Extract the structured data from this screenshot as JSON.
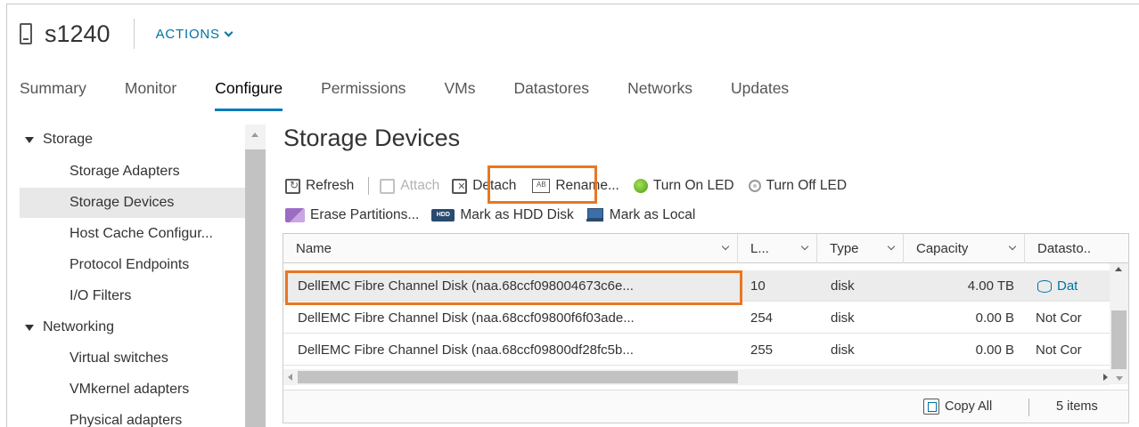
{
  "header": {
    "host_title": "s1240",
    "actions_label": "ACTIONS"
  },
  "tabs": [
    {
      "label": "Summary",
      "active": false
    },
    {
      "label": "Monitor",
      "active": false
    },
    {
      "label": "Configure",
      "active": true
    },
    {
      "label": "Permissions",
      "active": false
    },
    {
      "label": "VMs",
      "active": false
    },
    {
      "label": "Datastores",
      "active": false
    },
    {
      "label": "Networks",
      "active": false
    },
    {
      "label": "Updates",
      "active": false
    }
  ],
  "nav": {
    "groups": [
      {
        "label": "Storage",
        "items": [
          "Storage Adapters",
          "Storage Devices",
          "Host Cache Configur...",
          "Protocol Endpoints",
          "I/O Filters"
        ]
      },
      {
        "label": "Networking",
        "items": [
          "Virtual switches",
          "VMkernel adapters",
          "Physical adapters"
        ]
      }
    ],
    "selected": "Storage Devices"
  },
  "main": {
    "title": "Storage Devices",
    "toolbar1": {
      "refresh": "Refresh",
      "attach": "Attach",
      "detach": "Detach",
      "rename": "Rename...",
      "led_on": "Turn On LED",
      "led_off": "Turn Off LED"
    },
    "toolbar2": {
      "erase": "Erase Partitions...",
      "hdd_badge": "HDD",
      "hdd": "Mark as HDD Disk",
      "local": "Mark as Local"
    }
  },
  "grid": {
    "columns": [
      "Name",
      "L...",
      "Type",
      "Capacity",
      "Datasto.."
    ],
    "rows": [
      {
        "name": "DellEMC Fibre Channel Disk (naa.68ccf098004673c6e...",
        "lun": "10",
        "type": "disk",
        "capacity": "4.00 TB",
        "datastore": "Dat"
      },
      {
        "name": "DellEMC Fibre Channel Disk (naa.68ccf09800f6f03ade...",
        "lun": "254",
        "type": "disk",
        "capacity": "0.00 B",
        "datastore": "Not Cor"
      },
      {
        "name": "DellEMC Fibre Channel Disk (naa.68ccf09800df28fc5b...",
        "lun": "255",
        "type": "disk",
        "capacity": "0.00 B",
        "datastore": "Not Cor"
      }
    ],
    "footer": {
      "copy_all": "Copy All",
      "item_count": "5 items"
    }
  },
  "colors": {
    "accent": "#0079b8",
    "link": "#0072a3",
    "highlight": "#e87722",
    "selected_row": "#ececec"
  }
}
